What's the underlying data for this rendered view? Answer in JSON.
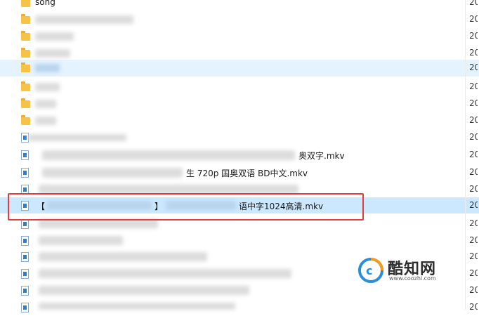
{
  "rows": [
    {
      "type": "folder",
      "name": "song",
      "date": "20"
    },
    {
      "type": "folder",
      "name": "",
      "date": "20"
    },
    {
      "type": "folder",
      "name": "",
      "date": "20"
    },
    {
      "type": "folder",
      "name": "",
      "date": "20"
    },
    {
      "type": "folder",
      "name": "",
      "date": "20",
      "selected": true
    },
    {
      "type": "folder",
      "name": "",
      "date": "20"
    },
    {
      "type": "folder",
      "name": "",
      "date": "20"
    },
    {
      "type": "folder",
      "name": "",
      "date": "20"
    },
    {
      "type": "video",
      "name": "",
      "date": "20"
    },
    {
      "type": "video",
      "name": "奥双字.mkv",
      "date": "20"
    },
    {
      "type": "video",
      "name": "生 720p 国奥双语 BD中文.mkv",
      "date": "20"
    },
    {
      "type": "video",
      "name": "",
      "date": "20"
    },
    {
      "type": "video",
      "name": "语中字1024高清.mkv",
      "date": "20",
      "highlighted": true,
      "bracket_open": "【",
      "bracket_close": "】"
    },
    {
      "type": "video",
      "name": "",
      "date": "20"
    },
    {
      "type": "video",
      "name": "",
      "date": "20"
    },
    {
      "type": "video",
      "name": "",
      "date": "20"
    },
    {
      "type": "video",
      "name": "",
      "date": "20"
    },
    {
      "type": "video",
      "name": "",
      "date": "20"
    },
    {
      "type": "video",
      "name": "",
      "date": "20"
    }
  ],
  "watermark": {
    "title": "酷知网",
    "url": "www.coozhi.com",
    "accent": "#2a8fd8",
    "accent2": "#f39c1f"
  },
  "colors": {
    "selection": "#e5f3ff",
    "highlight": "#cce8ff",
    "redbox": "#e43c3c"
  }
}
